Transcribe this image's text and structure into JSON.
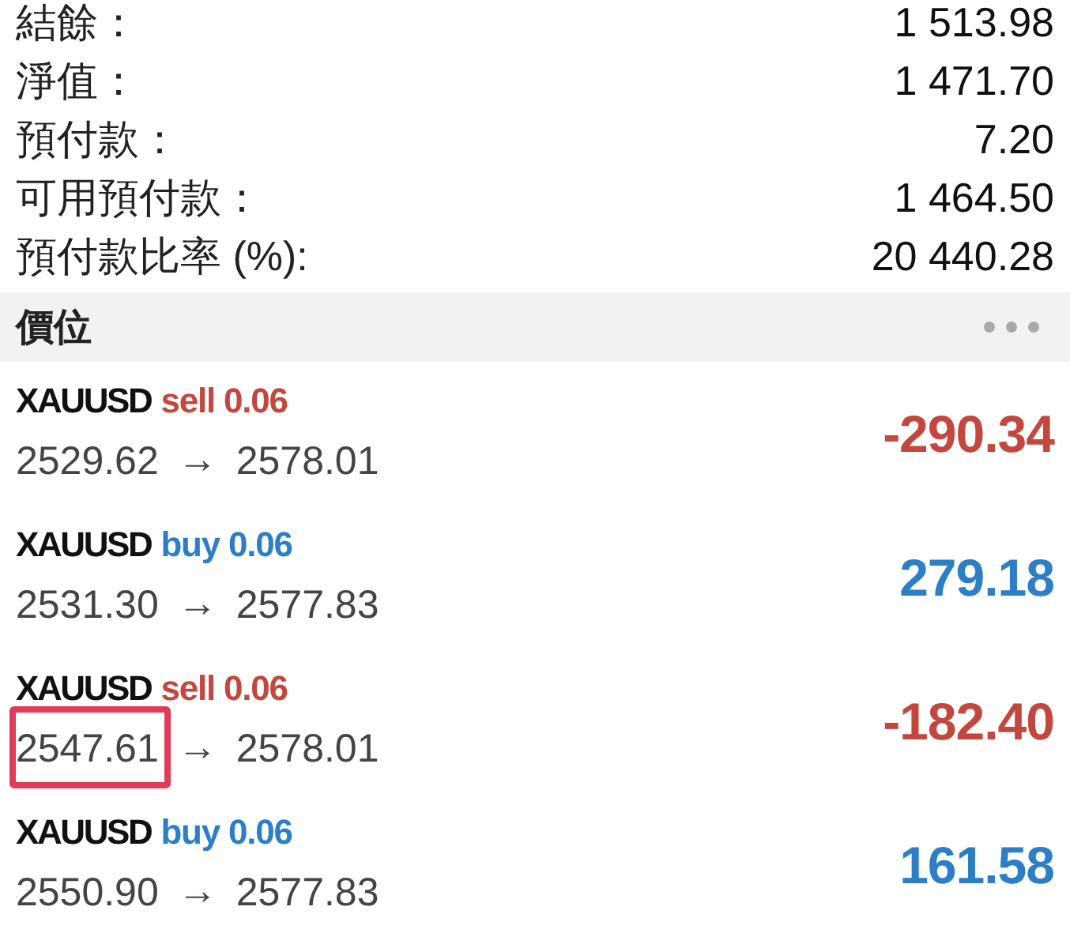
{
  "summary": [
    {
      "label": "結餘：",
      "value": "1 513.98"
    },
    {
      "label": "淨值：",
      "value": "1 471.70"
    },
    {
      "label": "預付款：",
      "value": "7.20"
    },
    {
      "label": "可用預付款：",
      "value": "1 464.50"
    },
    {
      "label": "預付款比率 (%):",
      "value": "20 440.28"
    }
  ],
  "positions_header": {
    "title": "價位"
  },
  "positions": [
    {
      "symbol": "XAUUSD",
      "order": "sell 0.06",
      "color": "#c4473d",
      "open_price": "2529.62",
      "arrow": "→",
      "current_price": "2578.01",
      "profit": "-290.34",
      "open_price_marked": false
    },
    {
      "symbol": "XAUUSD",
      "order": "buy 0.06",
      "color": "#2c7fc6",
      "open_price": "2531.30",
      "arrow": "→",
      "current_price": "2577.83",
      "profit": "279.18",
      "open_price_marked": false
    },
    {
      "symbol": "XAUUSD",
      "order": "sell 0.06",
      "color": "#c4473d",
      "open_price": "2547.61",
      "arrow": "→",
      "current_price": "2578.01",
      "profit": "-182.40",
      "open_price_marked": true
    },
    {
      "symbol": "XAUUSD",
      "order": "buy 0.06",
      "color": "#2c7fc6",
      "open_price": "2550.90",
      "arrow": "→",
      "current_price": "2577.83",
      "profit": "161.58",
      "open_price_marked": false
    }
  ]
}
